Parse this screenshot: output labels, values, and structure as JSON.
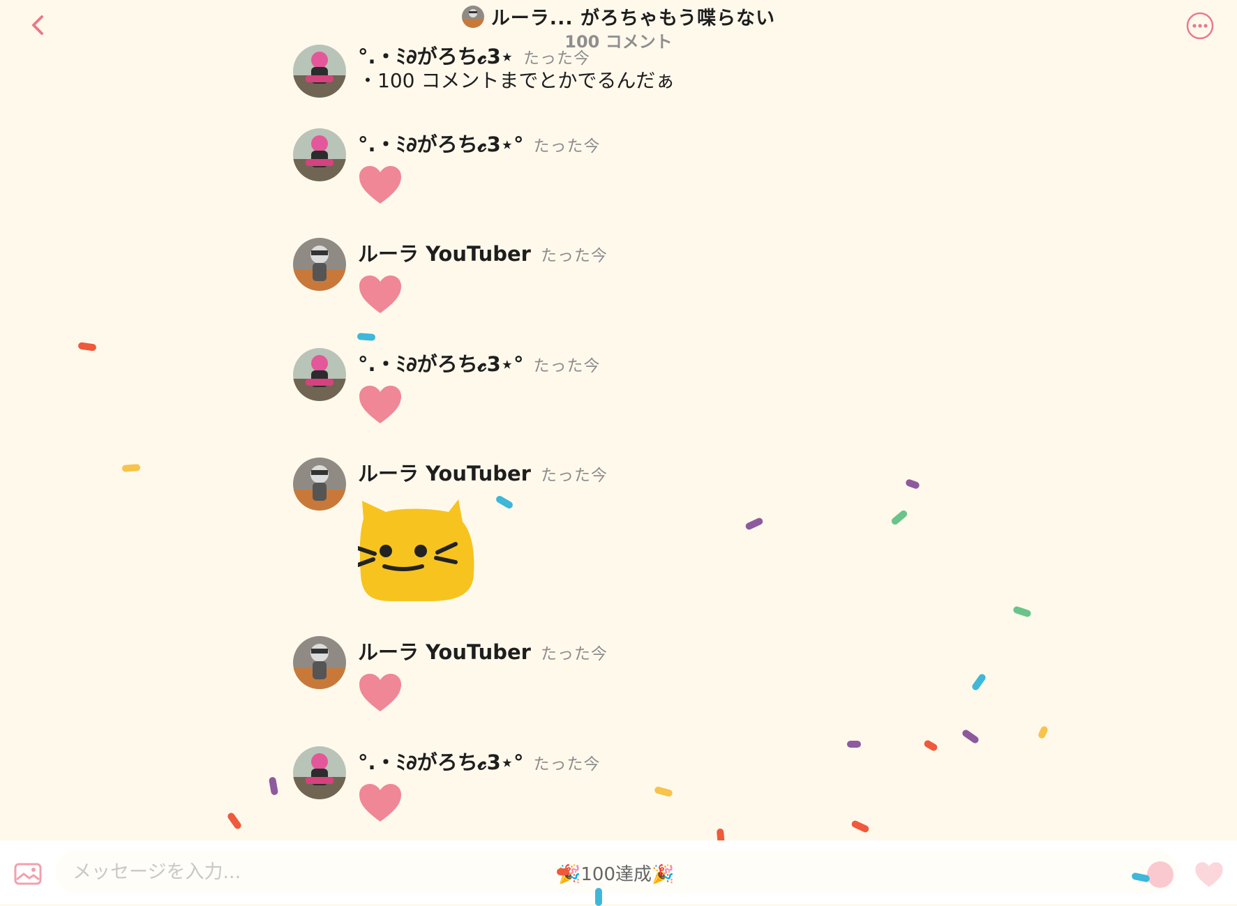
{
  "header": {
    "title": "ルーラ... がろちゃもう喋らない",
    "subtitle": "100 コメント"
  },
  "messages": [
    {
      "name": "°.・ﾐ∂がろち𝓬3⋆",
      "time": "たった今",
      "text": "・100 コメントまでとかでるんだぁ"
    },
    {
      "name": "°.・ﾐ∂がろち𝓬3⋆°",
      "time": "たった今",
      "content": "heart"
    },
    {
      "name": "ルーラ YouTuber",
      "time": "たった今",
      "content": "heart"
    },
    {
      "name": "°.・ﾐ∂がろち𝓬3⋆°",
      "time": "たった今",
      "content": "heart"
    },
    {
      "name": "ルーラ YouTuber",
      "time": "たった今",
      "content": "cat-sticker"
    },
    {
      "name": "ルーラ YouTuber",
      "time": "たった今",
      "content": "heart"
    },
    {
      "name": "°.・ﾐ∂がろち𝓬3⋆°",
      "time": "たった今",
      "content": "heart"
    }
  ],
  "input": {
    "placeholder": "メッセージを入力...",
    "milestone": "🎉100達成🎉"
  },
  "colors": {
    "background": "#fff9ec",
    "accent": "#e97a8a",
    "heart": "#ef8796",
    "sticker": "#f7c31f"
  },
  "icons": [
    "chevron-left-icon",
    "more-icon",
    "image-icon",
    "emoji-icon",
    "heart-icon"
  ]
}
